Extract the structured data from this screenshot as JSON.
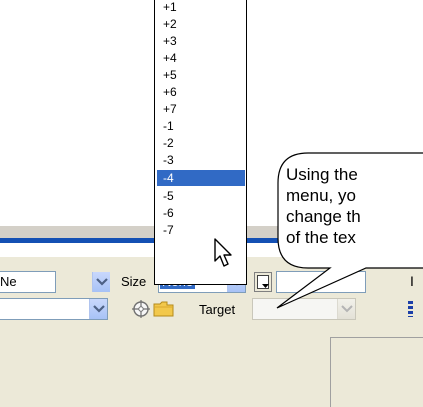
{
  "size_dropdown": {
    "options": [
      "+1",
      "+2",
      "+3",
      "+4",
      "+5",
      "+6",
      "+7",
      "-1",
      "-2",
      "-3",
      "-4",
      "-5",
      "-6",
      "-7"
    ],
    "selected_option": "-4"
  },
  "callout": {
    "lines": [
      "Using the",
      "menu, yo",
      "change th",
      "of the tex"
    ]
  },
  "inspector": {
    "row1": {
      "font_combo_value": "Ne",
      "size_label": "Size",
      "size_combo_value": "None",
      "trailing_char": "I"
    },
    "row2": {
      "target_label": "Target"
    }
  },
  "colors": {
    "selection": "#316ac5",
    "rule": "#1450b4",
    "inspector_bg": "#ece9d8"
  }
}
